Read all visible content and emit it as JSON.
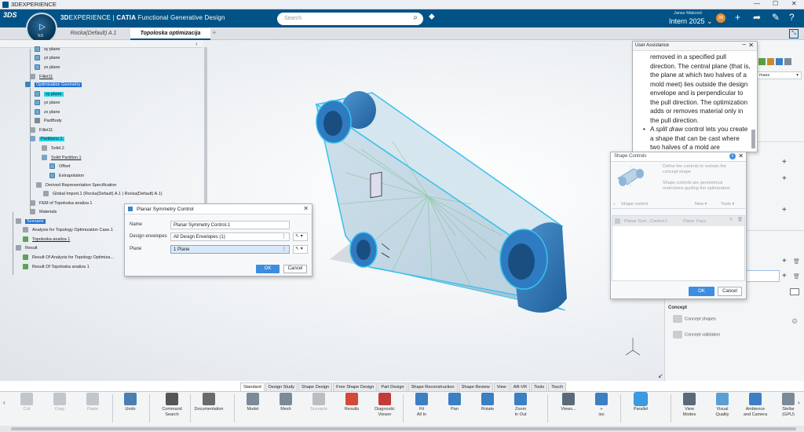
{
  "window": {
    "title": "3DEXPERIENCE"
  },
  "brand": {
    "prefix": "3D",
    "rest": "EXPERIENCE",
    "sep": " | ",
    "app_strong": "CATIA",
    "app_rest": " Functional Generative Design",
    "logo_text": "3DS"
  },
  "search": {
    "placeholder": "Search"
  },
  "user": {
    "name": "Janez Maković",
    "role": "Intern 2025",
    "role_caret": "Intern 2025 ⌄",
    "initials": "JM"
  },
  "compass": {
    "version": "V.6"
  },
  "tabs": [
    {
      "label": "Rocka(Default) A.1"
    },
    {
      "label": "Topoloska optimizacija"
    }
  ],
  "tree": {
    "items": [
      {
        "label": "xy plane"
      },
      {
        "label": "yz plane"
      },
      {
        "label": "zx plane"
      },
      {
        "label": "Fillet11"
      },
      {
        "label": "Optimization Geometry"
      },
      {
        "label": "xy plane"
      },
      {
        "label": "yz plane"
      },
      {
        "label": "zx plane"
      },
      {
        "label": "PartBody"
      },
      {
        "label": "Fillet11"
      },
      {
        "label": "Partitions.1"
      },
      {
        "label": "Solid.2"
      },
      {
        "label": "Solid Partition.1"
      },
      {
        "label": "Offset"
      },
      {
        "label": "Extrapolation"
      },
      {
        "label": "Derived Representation Specification"
      },
      {
        "label": "Global Import.1 (Rocka(Default) A.1 | Rocka(Default) A.1)"
      },
      {
        "label": "FEM of Topoloska analiza 1"
      },
      {
        "label": "Materials"
      },
      {
        "label": "Scenario"
      },
      {
        "label": "Analysis for Topology Optimization Case.1"
      },
      {
        "label": "Topoloska analiza 1"
      },
      {
        "label": "Result"
      },
      {
        "label": "Result Of Analysis for Topology Optimiza..."
      },
      {
        "label": "Result Of Topoloska analiza 1"
      }
    ]
  },
  "planar_dialog": {
    "title": "Planar Symmetry Control",
    "name_label": "Name",
    "name_value": "Planar Symmetry Control.1",
    "envelopes_label": "Design envelopes",
    "envelopes_value": "All Design Envelopes (1)",
    "plane_label": "Plane",
    "plane_value": "1 Plane",
    "ok": "OK",
    "cancel": "Cancel"
  },
  "user_assistance": {
    "title": "User Assistance",
    "para": "removed in a specified pull direction. The central plane (that is, the plane at which two halves of a mold meet) lies outside the design envelope and is perpendicular to the pull direction. The optimization adds or removes material only in the pull direction.",
    "bullet_prefix": "A ",
    "bullet_em": "split draw",
    "bullet_rest": " control lets you create a shape that can be cast where two halves of a mold are"
  },
  "shape_controls": {
    "title": "Shape Controls",
    "desc1": "Define the controls to restrain the concept shape",
    "desc2": "Shape controls are geometrical restrictions guiding the optimization",
    "col_shape": "Shape control",
    "col_new": "New",
    "col_tools": "Tools",
    "row_name": "Planar Sym...Control.1",
    "row_type": "Plane: Face",
    "ok": "OK",
    "cancel": "Cancel"
  },
  "right_panel": {
    "dropdown": "mass"
  },
  "concept": {
    "title": "Concept",
    "items": [
      {
        "label": "Concept shapes"
      },
      {
        "label": "Concept validation"
      }
    ]
  },
  "section_tabs": [
    "Standard",
    "Design Study",
    "Shape Design",
    "Free Shape Design",
    "Part Design",
    "Shape Reconstruction",
    "Shape Review",
    "View",
    "AR-VR",
    "Tools",
    "Touch"
  ],
  "action_bar": [
    {
      "label": "Cut"
    },
    {
      "label": "Copy"
    },
    {
      "label": "Paste"
    },
    {
      "label": "Undo"
    },
    {
      "label": "Command\nSearch"
    },
    {
      "label": "Documentation"
    },
    {
      "label": "Model"
    },
    {
      "label": "Mesh"
    },
    {
      "label": "Scenario"
    },
    {
      "label": "Results"
    },
    {
      "label": "Diagnostic\nViewer"
    },
    {
      "label": "Fit\nAll In"
    },
    {
      "label": "Pan"
    },
    {
      "label": "Rotate"
    },
    {
      "label": "Zoom\nIn Out"
    },
    {
      "label": "Views..."
    },
    {
      "label": "+\niso"
    },
    {
      "label": "Parallel"
    },
    {
      "label": "View\nModes"
    },
    {
      "label": "Visual\nQuality"
    },
    {
      "label": "Ambience\nand Camera"
    },
    {
      "label": "Stellar\n(GPU)"
    }
  ],
  "colors": {
    "brand_blue": "#005386",
    "part_blue": "#3b7fc4",
    "highlight_cyan": "#1fd3e6",
    "ok_blue": "#3d8de0"
  }
}
